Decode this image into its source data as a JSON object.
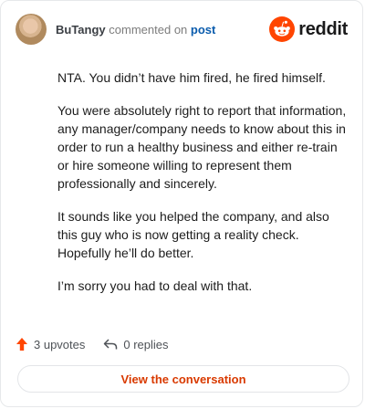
{
  "header": {
    "username": "BuTangy",
    "action_text": "commented on",
    "link_text": "post",
    "brand": "reddit"
  },
  "comment": {
    "paragraphs": [
      "NTA. You didn’t have him fired, he fired himself.",
      "You were absolutely right to report that information, any manager/company needs to know about this in order to run a healthy business and either re-train or hire someone willing to represent them professionally and sincerely.",
      "It sounds like you helped the company, and also this guy who is now getting a reality check. Hopefully he’ll do better.",
      "I’m sorry you had to deal with that."
    ]
  },
  "actions": {
    "upvotes": "3 upvotes",
    "replies": "0 replies"
  },
  "cta": {
    "label": "View the conversation"
  },
  "colors": {
    "brand": "#ff4500",
    "link": "#0b5cad",
    "cta": "#d93a00"
  },
  "icons": [
    "avatar",
    "reddit-snoo-icon",
    "upvote-arrow-icon",
    "reply-icon"
  ]
}
